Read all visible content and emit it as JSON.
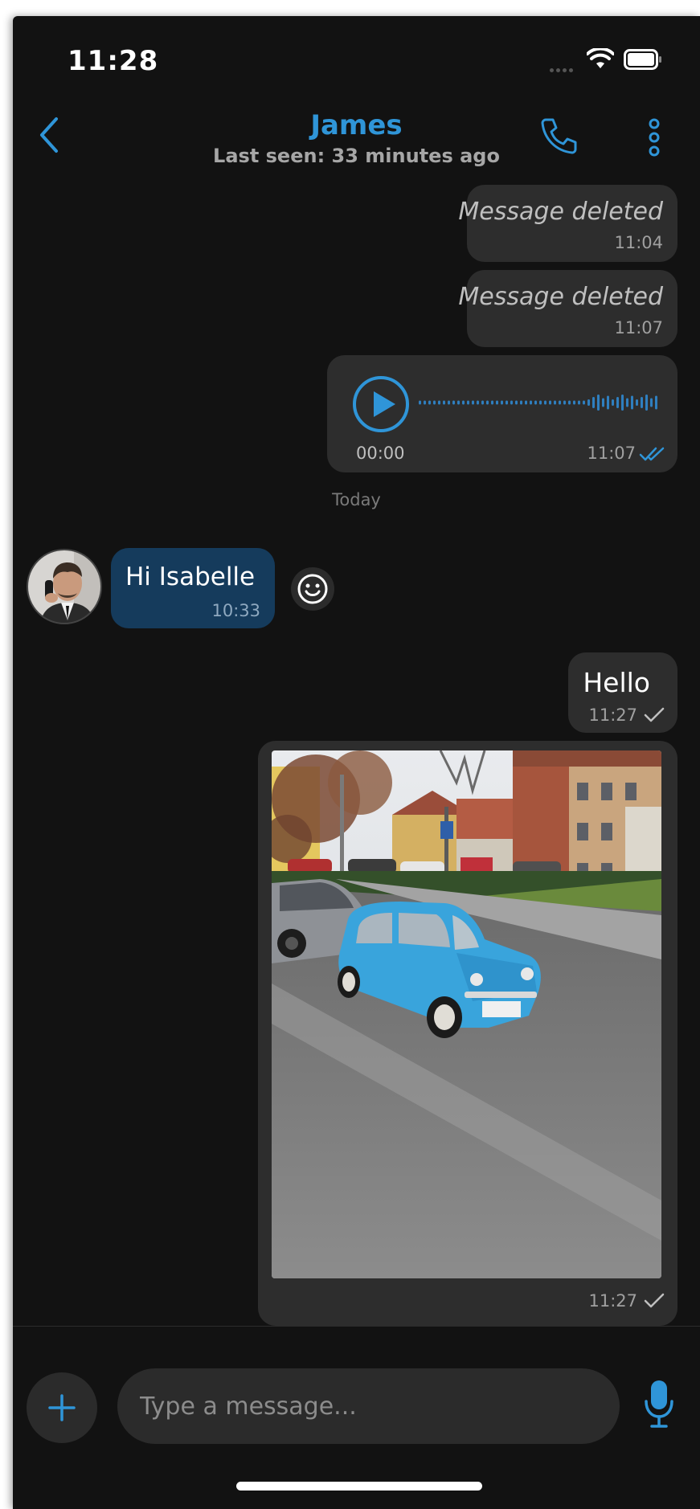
{
  "status_bar": {
    "time": "11:28"
  },
  "header": {
    "contact_name": "James",
    "last_seen": "Last seen: 33 minutes ago"
  },
  "messages": [
    {
      "type": "deleted",
      "text": "Message deleted",
      "time": "11:04"
    },
    {
      "type": "deleted",
      "text": "Message deleted",
      "time": "11:07"
    },
    {
      "type": "voice",
      "duration": "00:00",
      "time": "11:07",
      "status": "read"
    },
    {
      "type": "date_separator",
      "text": "Today"
    },
    {
      "type": "incoming_text",
      "text": "Hi Isabelle",
      "time": "10:33"
    },
    {
      "type": "outgoing_text",
      "text": "Hello",
      "time": "11:27",
      "status": "sent"
    },
    {
      "type": "outgoing_image",
      "time": "11:27",
      "status": "sent"
    }
  ],
  "composer": {
    "placeholder": "Type a message..."
  },
  "colors": {
    "accent": "#2f95d8",
    "background": "#121212",
    "bubble_outgoing": "#2d2d2d",
    "bubble_incoming": "#153b5c"
  },
  "icons": [
    "back-chevron-icon",
    "phone-icon",
    "more-vertical-icon",
    "play-icon",
    "double-check-icon",
    "check-icon",
    "smiley-icon",
    "plus-icon",
    "microphone-icon",
    "wifi-icon",
    "battery-icon"
  ]
}
